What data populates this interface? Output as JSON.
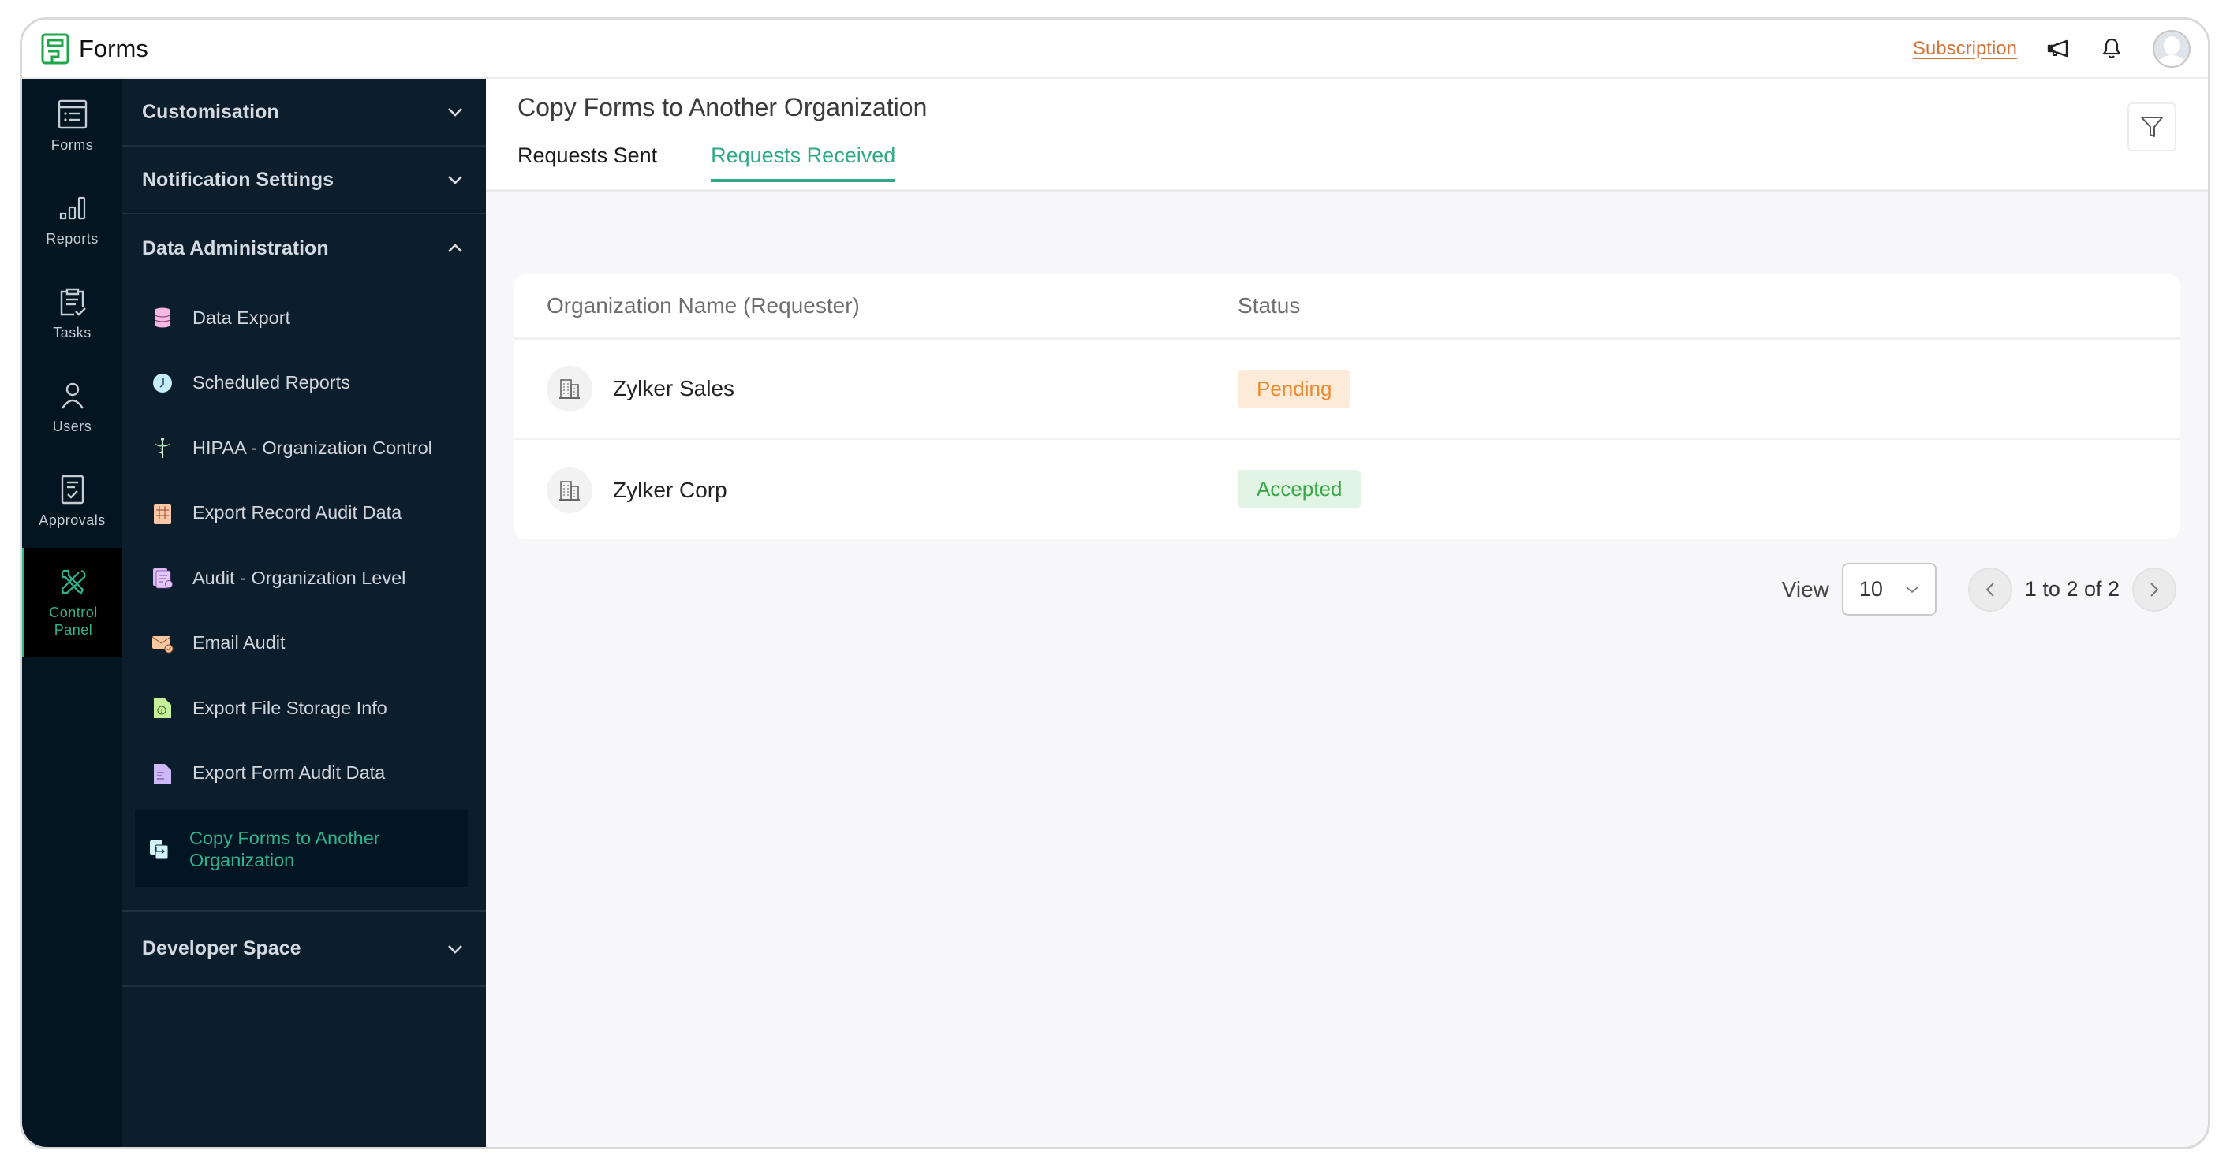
{
  "app": {
    "name": "Forms",
    "subscription_link": "Subscription",
    "icons": {
      "logo": "forms-logo",
      "announcement": "megaphone-icon",
      "notifications": "bell-icon",
      "avatar": "user-avatar"
    }
  },
  "rail": {
    "items": [
      {
        "label": "Forms",
        "icon": "forms-list-icon"
      },
      {
        "label": "Reports",
        "icon": "bar-chart-icon"
      },
      {
        "label": "Tasks",
        "icon": "clipboard-check-icon"
      },
      {
        "label": "Users",
        "icon": "user-icon"
      },
      {
        "label": "Approvals",
        "icon": "approval-doc-icon"
      },
      {
        "label_line1": "Control",
        "label_line2": "Panel",
        "icon": "tools-icon",
        "active": true
      }
    ]
  },
  "sidebar": {
    "sections": [
      {
        "label": "Customisation",
        "expanded": false
      },
      {
        "label": "Notification Settings",
        "expanded": false
      },
      {
        "label": "Data Administration",
        "expanded": true
      },
      {
        "label": "Developer Space",
        "expanded": false
      }
    ],
    "data_admin_items": [
      {
        "label": "Data Export",
        "icon": "database-icon"
      },
      {
        "label": "Scheduled Reports",
        "icon": "clock-icon"
      },
      {
        "label": "HIPAA - Organization Control",
        "icon": "caduceus-icon"
      },
      {
        "label": "Export Record Audit Data",
        "icon": "grid-doc-icon"
      },
      {
        "label": "Audit - Organization Level",
        "icon": "audit-docs-icon"
      },
      {
        "label": "Email Audit",
        "icon": "email-check-icon"
      },
      {
        "label": "Export File Storage Info",
        "icon": "file-info-icon"
      },
      {
        "label": "Export Form Audit Data",
        "icon": "file-text-icon"
      },
      {
        "label": "Copy Forms to Another Organization",
        "icon": "copy-forms-icon",
        "active": true
      }
    ]
  },
  "main": {
    "title": "Copy Forms to Another Organization",
    "tabs": [
      {
        "label": "Requests Sent",
        "active": false
      },
      {
        "label": "Requests Received",
        "active": true
      }
    ],
    "filter_icon": "filter-icon",
    "table": {
      "columns": [
        "Organization Name (Requester)",
        "Status"
      ],
      "rows": [
        {
          "organization": "Zylker Sales",
          "status": "Pending"
        },
        {
          "organization": "Zylker Corp",
          "status": "Accepted"
        }
      ]
    },
    "pagination": {
      "view_label": "View",
      "page_size": "10",
      "range_text": "1 to 2 of 2"
    }
  },
  "colors": {
    "accent": "#2fa986",
    "rail_bg": "#021520",
    "sidebar_bg": "#0c1d2b",
    "subscription": "#d3743a",
    "pending": "#ec8a30",
    "accepted": "#3aa84a"
  }
}
